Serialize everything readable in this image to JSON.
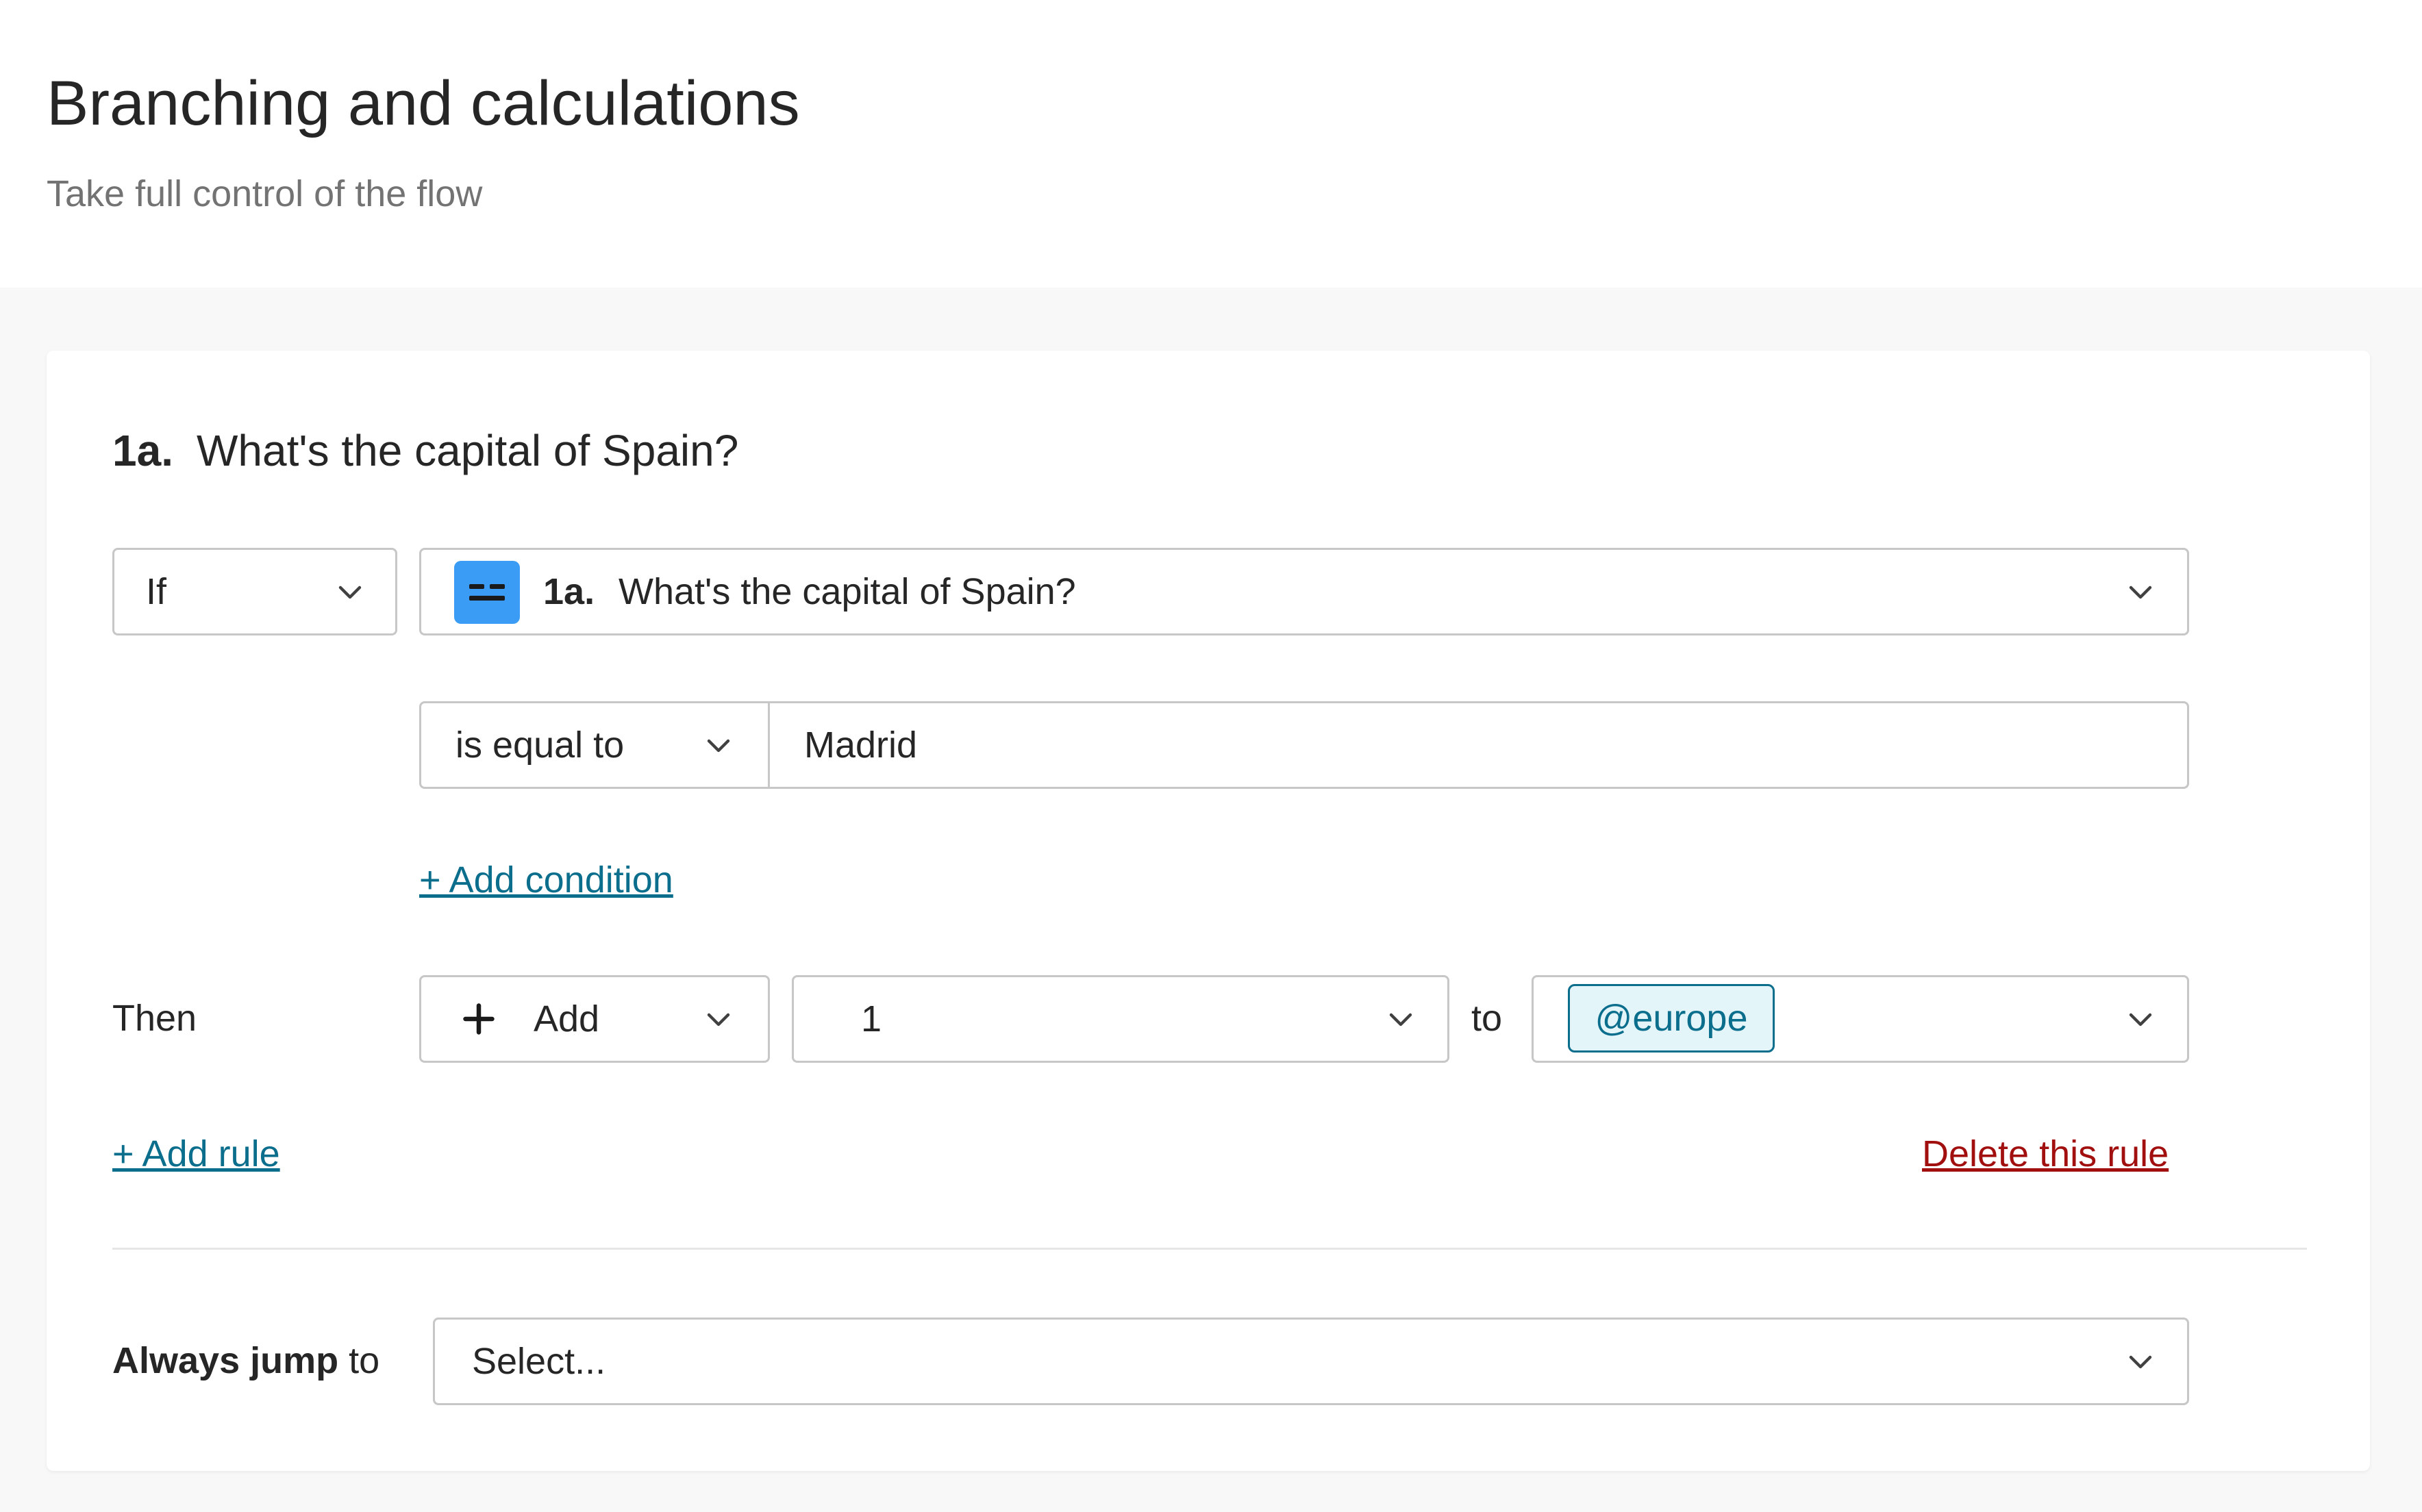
{
  "header": {
    "title": "Branching and calculations",
    "subtitle": "Take full control of the flow"
  },
  "question": {
    "number": "1a.",
    "text": "What's the capital of Spain?"
  },
  "rule": {
    "if_select": {
      "value": "If"
    },
    "question_select": {
      "icon": "equals-icon",
      "number": "1a.",
      "text": "What's the capital of Spain?"
    },
    "operator_select": {
      "value": "is equal to"
    },
    "answer_input": {
      "value": "Madrid"
    },
    "add_condition_label": "+ Add condition",
    "then_label": "Then",
    "action_select": {
      "icon": "plus-icon",
      "value": "Add"
    },
    "amount_select": {
      "value": "1"
    },
    "to_label": "to",
    "variable_select": {
      "tag": "@europe"
    },
    "add_rule_label": "+ Add rule",
    "delete_rule_label": "Delete this rule"
  },
  "always_jump": {
    "label_bold": "Always jump",
    "label_rest": " to",
    "select": {
      "placeholder": "Select..."
    }
  },
  "colors": {
    "accent_link": "#0b6e8c",
    "danger_link": "#a10f0f",
    "question_icon_bg": "#3b9cf5",
    "tag_bg": "#e4f5f9"
  }
}
